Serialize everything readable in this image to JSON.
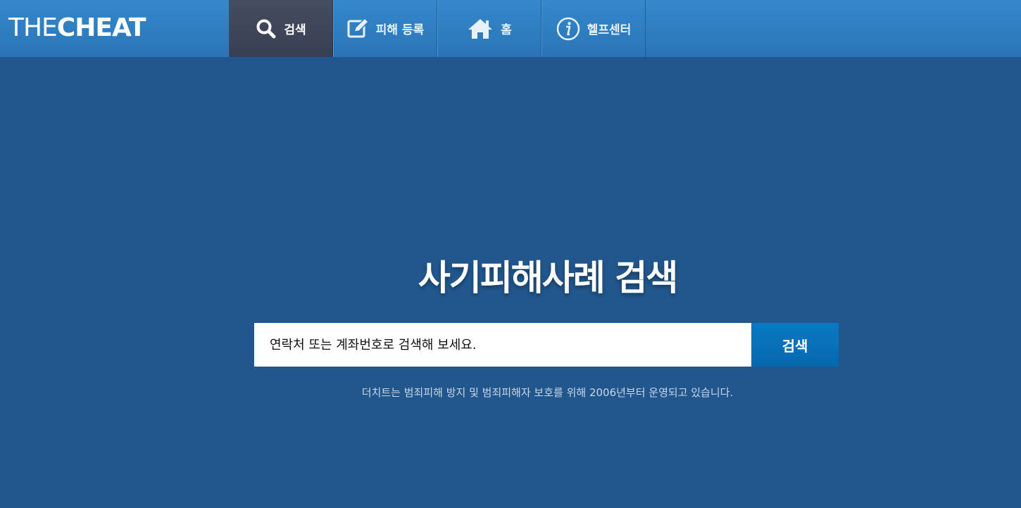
{
  "logo": {
    "light": "THE",
    "bold": "CHEAT"
  },
  "nav": {
    "items": [
      {
        "label": "검색",
        "icon": "search-icon",
        "active": true
      },
      {
        "label": "피해 등록",
        "icon": "edit-icon",
        "active": false
      },
      {
        "label": "홈",
        "icon": "home-icon",
        "active": false
      },
      {
        "label": "헬프센터",
        "icon": "info-icon",
        "active": false
      }
    ]
  },
  "hero": {
    "title": "사기피해사례 검색"
  },
  "search": {
    "placeholder": "연락처 또는 계좌번호로 검색해 보세요.",
    "button_label": "검색"
  },
  "notice": "더치트는 범죄피해 방지 및 범죄피해자 보호를 위해 2006년부터 운영되고 있습니다.",
  "colors": {
    "background": "#22578e",
    "topbar": "#2f80c2",
    "active_tab": "#3f4558",
    "search_button": "#0a72bc"
  }
}
